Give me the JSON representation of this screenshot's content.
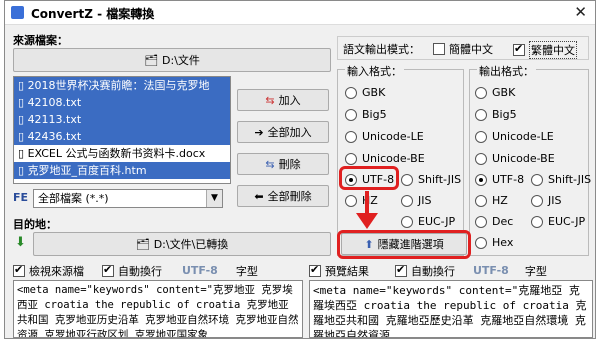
{
  "window": {
    "title": "ConvertZ - 檔案轉換",
    "close_glyph": "✕"
  },
  "source": {
    "label": "來源檔案：",
    "path_label": "D:\\文件",
    "files": [
      {
        "name": "2018世界杯决赛前瞻：法国与克罗地",
        "selected": true
      },
      {
        "name": "42108.txt",
        "selected": true
      },
      {
        "name": "42113.txt",
        "selected": true
      },
      {
        "name": "42436.txt",
        "selected": true
      },
      {
        "name": "EXCEL 公式与函数新书资料卡.docx",
        "selected": false
      },
      {
        "name": "克罗地亚_百度百科.htm",
        "selected": true
      }
    ],
    "filter_prefix": "FE",
    "filter_value": "全部檔案 (*.*)"
  },
  "actions": {
    "add": "加入",
    "add_all": "全部加入",
    "remove": "刪除",
    "remove_all": "全部刪除"
  },
  "dest": {
    "label": "目的地：",
    "path_label": "D:\\文件\\已轉換"
  },
  "output_mode": {
    "label": "語文輸出模式：",
    "simplified": "簡體中文",
    "traditional": "繁體中文"
  },
  "input_format": {
    "title": "輸入格式：",
    "options": [
      "GBK",
      "Big5",
      "Unicode-LE",
      "Unicode-BE",
      "UTF-8",
      "Shift-JIS",
      "HZ",
      "JIS",
      "EUC-JP"
    ],
    "selected": "UTF-8"
  },
  "output_format": {
    "title": "輸出格式：",
    "options": [
      "GBK",
      "Big5",
      "Unicode-LE",
      "Unicode-BE",
      "UTF-8",
      "Shift-JIS",
      "HZ",
      "JIS",
      "Dec",
      "EUC-JP",
      "Hex"
    ],
    "selected": "UTF-8"
  },
  "hide_advanced": "隱藏進階選項",
  "left_pane": {
    "view_source": "檢視來源檔",
    "wrap": "自動換行",
    "encoding": "UTF-8",
    "font": "字型",
    "content": "<meta name=\"keywords\" content=\"克罗地亚 克罗埃西亚 croatia the republic of croatia 克罗地亚共和国 克罗地亚历史沿革 克罗地亚自然环境 克罗地亚自然资源 克罗地亚行政区划 克罗地亚国家象"
  },
  "right_pane": {
    "preview": "預覽結果",
    "wrap": "自動換行",
    "encoding": "UTF-8",
    "font": "字型",
    "content": "<meta name=\"keywords\" content=\"克羅地亞 克羅埃西亞 croatia the republic of croatia 克羅地亞共和國 克羅地亞歷史沿革 克羅地亞自然環境 克羅地亞自然資源"
  },
  "colors": {
    "accent": "#3b6cc2",
    "highlight": "#e02020",
    "encoding_label": "#7a8fb0"
  }
}
